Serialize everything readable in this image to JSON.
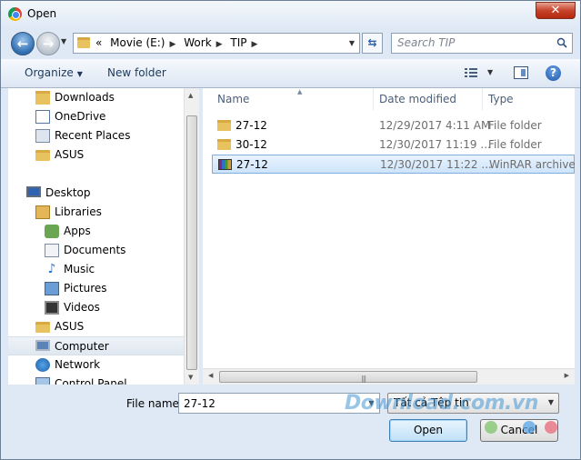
{
  "window": {
    "title": "Open",
    "close_label": "✕"
  },
  "nav": {
    "address_path": [
      "Movie (E:)",
      "Work",
      "TIP"
    ],
    "address_prefix": "«",
    "search_placeholder": "Search TIP"
  },
  "toolbar": {
    "organize_label": "Organize",
    "new_folder_label": "New folder"
  },
  "sidebar": {
    "items": [
      {
        "label": "Downloads",
        "icon": "downloads-folder-icon"
      },
      {
        "label": "OneDrive",
        "icon": "onedrive-icon"
      },
      {
        "label": "Recent Places",
        "icon": "recent-places-icon"
      },
      {
        "label": "ASUS",
        "icon": "folder-icon"
      },
      {
        "label": "Desktop",
        "icon": "desktop-icon"
      },
      {
        "label": "Libraries",
        "icon": "libraries-icon"
      },
      {
        "label": "Apps",
        "icon": "apps-icon"
      },
      {
        "label": "Documents",
        "icon": "documents-icon"
      },
      {
        "label": "Music",
        "icon": "music-icon"
      },
      {
        "label": "Pictures",
        "icon": "pictures-icon"
      },
      {
        "label": "Videos",
        "icon": "videos-icon"
      },
      {
        "label": "ASUS",
        "icon": "user-folder-icon"
      },
      {
        "label": "Computer",
        "icon": "computer-icon"
      },
      {
        "label": "Network",
        "icon": "network-icon"
      },
      {
        "label": "Control Panel",
        "icon": "control-panel-icon"
      }
    ]
  },
  "filelist": {
    "columns": [
      "Name",
      "Date modified",
      "Type"
    ],
    "rows": [
      {
        "name": "27-12",
        "date": "12/29/2017 4:11 AM",
        "type": "File folder",
        "icon": "folder-icon"
      },
      {
        "name": "30-12",
        "date": "12/30/2017 11:19 ...",
        "type": "File folder",
        "icon": "folder-icon"
      },
      {
        "name": "27-12",
        "date": "12/30/2017 11:22 ...",
        "type": "WinRAR archive",
        "icon": "winrar-archive-icon"
      }
    ]
  },
  "footer": {
    "filename_label": "File name:",
    "filename_value": "27-12",
    "filter_value": "Tất cả Tệp tin",
    "open_label": "Open",
    "cancel_label": "Cancel"
  },
  "watermark": "Download.com.vn"
}
